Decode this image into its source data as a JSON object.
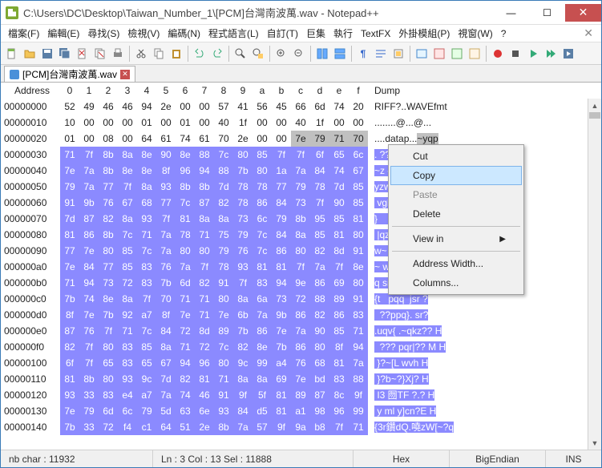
{
  "title": "C:\\Users\\DC\\Desktop\\Taiwan_Number_1\\[PCM]台灣南波萬.wav - Notepad++",
  "menu": [
    "檔案(F)",
    "編輯(E)",
    "尋找(S)",
    "檢視(V)",
    "編碼(N)",
    "程式語言(L)",
    "自訂(T)",
    "巨集",
    "執行",
    "TextFX",
    "外掛模組(P)",
    "視窗(W)",
    "?"
  ],
  "tab": "[PCM]台灣南波萬.wav",
  "hexHeader": [
    "0",
    "1",
    "2",
    "3",
    "4",
    "5",
    "6",
    "7",
    "8",
    "9",
    "a",
    "b",
    "c",
    "d",
    "e",
    "f"
  ],
  "hexDumpLabel": "Dump",
  "rows": [
    {
      "addr": "00000000",
      "bytes": [
        "52",
        "49",
        "46",
        "46",
        "94",
        "2e",
        "00",
        "00",
        "57",
        "41",
        "56",
        "45",
        "66",
        "6d",
        "74",
        "20"
      ],
      "dump": "RIFF?..WAVEfmt  ",
      "selStart": -1,
      "selPlain": true
    },
    {
      "addr": "00000010",
      "bytes": [
        "10",
        "00",
        "00",
        "00",
        "01",
        "00",
        "01",
        "00",
        "40",
        "1f",
        "00",
        "00",
        "40",
        "1f",
        "00",
        "00"
      ],
      "dump": "........@...@...",
      "selStart": -1,
      "selPlain": true
    },
    {
      "addr": "00000020",
      "bytes": [
        "01",
        "00",
        "08",
        "00",
        "64",
        "61",
        "74",
        "61",
        "70",
        "2e",
        "00",
        "00",
        "7e",
        "79",
        "71",
        "70"
      ],
      "dump": "....datap...~yqp",
      "selStart": 12,
      "curRow": true
    },
    {
      "addr": "00000030",
      "bytes": [
        "71",
        "7f",
        "8b",
        "8a",
        "8e",
        "90",
        "8e",
        "88",
        "7c",
        "80",
        "85",
        "7f",
        "7f",
        "6f",
        "65",
        "6c"
      ],
      "dump": ". ??|?oel H",
      "selStart": 0
    },
    {
      "addr": "00000040",
      "bytes": [
        "7e",
        "7a",
        "8b",
        "8e",
        "8e",
        "8f",
        "96",
        "94",
        "88",
        "7b",
        "80",
        "1a",
        "7a",
        "84",
        "74",
        "67"
      ],
      "dump": "~z {  z tg  b",
      "selStart": 0
    },
    {
      "addr": "00000050",
      "bytes": [
        "79",
        "7a",
        "77",
        "7f",
        "8a",
        "93",
        "8b",
        "8b",
        "7d",
        "78",
        "78",
        "77",
        "79",
        "78",
        "7d",
        "85"
      ],
      "dump": "yzw  }xxwyx}   H",
      "selStart": 0
    },
    {
      "addr": "00000060",
      "bytes": [
        "91",
        "9b",
        "76",
        "67",
        "68",
        "77",
        "7c",
        "87",
        "82",
        "78",
        "86",
        "84",
        "73",
        "7f",
        "90",
        "85"
      ],
      "dump": " vghw|  x  s  { H",
      "selStart": 0
    },
    {
      "addr": "00000070",
      "bytes": [
        "7d",
        "87",
        "82",
        "8a",
        "93",
        "7f",
        "81",
        "8a",
        "8a",
        "73",
        "6c",
        "79",
        "8b",
        "95",
        "85",
        "81"
      ],
      "dump": "}     sly   z  H",
      "selStart": 0
    },
    {
      "addr": "00000080",
      "bytes": [
        "81",
        "86",
        "8b",
        "7c",
        "71",
        "7a",
        "78",
        "71",
        "75",
        "79",
        "7c",
        "84",
        "8a",
        "85",
        "81",
        "80"
      ],
      "dump": " |qzxquy|    .?",
      "selStart": 0
    },
    {
      "addr": "00000090",
      "bytes": [
        "77",
        "7e",
        "80",
        "85",
        "7c",
        "7a",
        "80",
        "80",
        "79",
        "76",
        "7c",
        "86",
        "80",
        "82",
        "8d",
        "91"
      ],
      "dump": "w~  |z  yv|     H",
      "selStart": 0
    },
    {
      "addr": "000000a0",
      "bytes": [
        "7e",
        "84",
        "77",
        "85",
        "83",
        "76",
        "7a",
        "7f",
        "78",
        "93",
        "81",
        "81",
        "7f",
        "7a",
        "7f",
        "8e"
      ],
      "dump": "~ w  vz x    z  H",
      "selStart": 0
    },
    {
      "addr": "000000b0",
      "bytes": [
        "71",
        "94",
        "73",
        "72",
        "83",
        "7b",
        "6d",
        "82",
        "91",
        "7f",
        "83",
        "94",
        "9e",
        "86",
        "69",
        "80"
      ],
      "dump": "q sr {m       i H",
      "selStart": 0
    },
    {
      "addr": "000000c0",
      "bytes": [
        "7b",
        "74",
        "8e",
        "8a",
        "7f",
        "70",
        "71",
        "71",
        "80",
        "8a",
        "6a",
        "73",
        "72",
        "88",
        "89",
        "91"
      ],
      "dump": "{t   pqq  jsr ?",
      "selStart": 0
    },
    {
      "addr": "000000d0",
      "bytes": [
        "8f",
        "7e",
        "7b",
        "92",
        "a7",
        "8f",
        "7e",
        "71",
        "7e",
        "6b",
        "7a",
        "9b",
        "86",
        "82",
        "86",
        "83"
      ],
      "dump": "  ??ppq}. sr?",
      "selStart": 0
    },
    {
      "addr": "000000e0",
      "bytes": [
        "87",
        "76",
        "7f",
        "71",
        "7c",
        "84",
        "72",
        "8d",
        "89",
        "7b",
        "86",
        "7e",
        "7a",
        "90",
        "85",
        "71"
      ],
      "dump": ".uqv{ .~qkz?? H",
      "selStart": 0
    },
    {
      "addr": "000000f0",
      "bytes": [
        "82",
        "7f",
        "80",
        "83",
        "85",
        "8a",
        "71",
        "72",
        "7c",
        "82",
        "8e",
        "7b",
        "86",
        "80",
        "8f",
        "94"
      ],
      "dump": "  ??? pqr|?? M H",
      "selStart": 0
    },
    {
      "addr": "00000100",
      "bytes": [
        "6f",
        "7f",
        "65",
        "83",
        "65",
        "67",
        "94",
        "96",
        "80",
        "9c",
        "99",
        "a4",
        "76",
        "68",
        "81",
        "7a"
      ],
      "dump": " }?~[L wvh H",
      "selStart": 0
    },
    {
      "addr": "00000110",
      "bytes": [
        "81",
        "8b",
        "80",
        "93",
        "9c",
        "7d",
        "82",
        "81",
        "71",
        "8a",
        "8a",
        "69",
        "7e",
        "bd",
        "83",
        "88"
      ],
      "dump": " }?b~?}Xj? H",
      "selStart": 0
    },
    {
      "addr": "00000120",
      "bytes": [
        "93",
        "33",
        "83",
        "e4",
        "a7",
        "7a",
        "74",
        "46",
        "91",
        "9f",
        "5f",
        "81",
        "89",
        "87",
        "8c",
        "9f"
      ],
      "dump": " I3 囫TF ?.? H",
      "selStart": 0
    },
    {
      "addr": "00000130",
      "bytes": [
        "7e",
        "79",
        "6d",
        "6c",
        "79",
        "5d",
        "63",
        "6e",
        "93",
        "84",
        "d5",
        "81",
        "a1",
        "98",
        "96",
        "99"
      ],
      "dump": " y ml y]cn?E H",
      "selStart": 0
    },
    {
      "addr": "00000140",
      "bytes": [
        "7b",
        "33",
        "72",
        "f4",
        "c1",
        "64",
        "51",
        "2e",
        "8b",
        "7a",
        "57",
        "9f",
        "9a",
        "b8",
        "7f",
        "71"
      ],
      "dump": "{3r鑽dQ.嘵zW[~?q",
      "selStart": 0
    }
  ],
  "context": {
    "cut": "Cut",
    "copy": "Copy",
    "paste": "Paste",
    "delete": "Delete",
    "viewin": "View in",
    "addrwidth": "Address Width...",
    "columns": "Columns..."
  },
  "status": {
    "nbchar": "nb char : 11932",
    "lncol": "Ln : 3   Col : 13   Sel : 11888",
    "mode": "Hex",
    "endian": "BigEndian",
    "ins": "INS"
  },
  "colors": {
    "sel": "#8b8aff",
    "cur": "#c0c0c0"
  }
}
